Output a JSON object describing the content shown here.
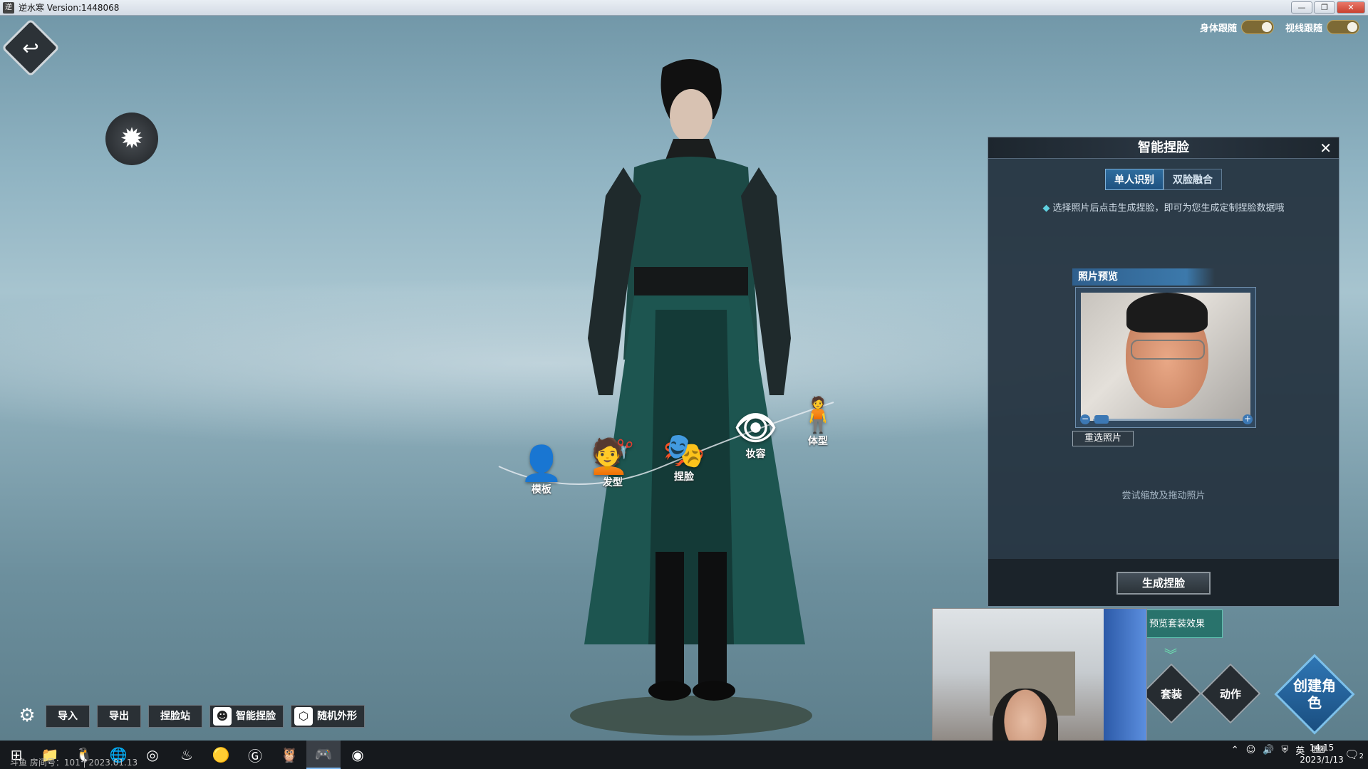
{
  "window": {
    "title": "逆水寒 Version:1448068",
    "minimize": "—",
    "restore": "❐",
    "close": "✕"
  },
  "top_toggles": [
    {
      "label": "身体跟随",
      "on": true
    },
    {
      "label": "视线跟随",
      "on": true
    }
  ],
  "wheel": [
    {
      "label": "模板",
      "icon": "👤"
    },
    {
      "label": "发型",
      "icon": "💇"
    },
    {
      "label": "捏脸",
      "icon": "🎭"
    },
    {
      "label": "妆容",
      "icon": "👁"
    },
    {
      "label": "体型",
      "icon": "🧍"
    }
  ],
  "panel": {
    "title": "智能捏脸",
    "close": "✕",
    "tabs": [
      "单人识别",
      "双脸融合"
    ],
    "active_tab": 0,
    "hint": "选择照片后点击生成捏脸，即可为您生成定制捏脸数据哦",
    "preview_title": "照片预览",
    "zoom_minus": "−",
    "zoom_plus": "+",
    "reselect": "重选照片",
    "zoom_hint": "尝试缩放及拖动照片",
    "generate": "生成捏脸"
  },
  "right_bottom": {
    "suit_preview": "预览套装效果",
    "chevron": "︾",
    "suit": "套装",
    "action": "动作",
    "create": "创建角色"
  },
  "toolbar": {
    "gear": "⚙",
    "import": "导入",
    "export": "导出",
    "face_station": "捏脸站",
    "smart_face": "智能捏脸",
    "random_look": "随机外形"
  },
  "taskbar": {
    "room_text": "斗鱼 房间号：101 | 2023.01.13",
    "tray_lang": "英",
    "time": "14:15",
    "date": "2023/1/13",
    "notif_count": "2"
  }
}
